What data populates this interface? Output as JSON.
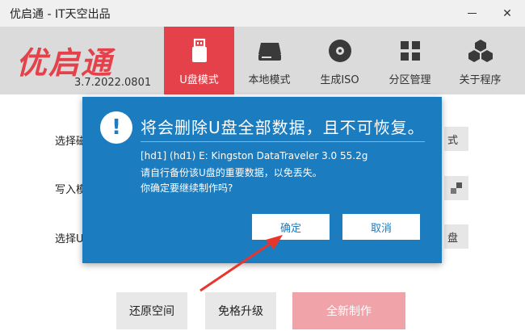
{
  "window": {
    "title": "优启通 - IT天空出品"
  },
  "header": {
    "logo_text": "优启通",
    "version": "3.7.2022.0801",
    "nav": [
      {
        "label": "U盘模式",
        "icon": "usb-drive-icon",
        "active": true
      },
      {
        "label": "本地模式",
        "icon": "hard-drive-icon",
        "active": false
      },
      {
        "label": "生成ISO",
        "icon": "disc-icon",
        "active": false
      },
      {
        "label": "分区管理",
        "icon": "grid-icon",
        "active": false
      },
      {
        "label": "关于程序",
        "icon": "cubes-icon",
        "active": false
      }
    ]
  },
  "main": {
    "rows": [
      {
        "label": "选择磁",
        "side_label": "式"
      },
      {
        "label": "写入模",
        "side_label": ""
      },
      {
        "label": "选择U",
        "side_label": "盘"
      }
    ],
    "buttons": {
      "restore": "还原空间",
      "upgrade": "免格升级",
      "new_build": "全新制作"
    }
  },
  "dialog": {
    "title": "将会删除U盘全部数据，且不可恢复。",
    "lines": [
      "[hd1] (hd1) E: Kingston DataTraveler 3.0 55.2g",
      "请自行备份该U盘的重要数据，以免丢失。",
      "你确定要继续制作吗?"
    ],
    "ok_label": "确定",
    "cancel_label": "取消"
  },
  "colors": {
    "accent": "#e4414a",
    "dialog_bg": "#1b7cc0",
    "arrow": "#e8352e"
  }
}
